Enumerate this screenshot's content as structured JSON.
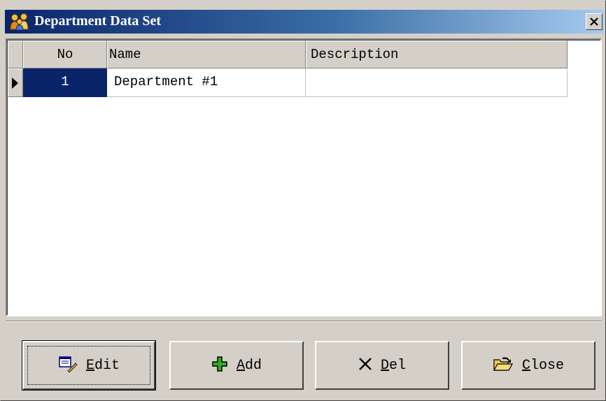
{
  "window": {
    "title": "Department Data Set",
    "icon": "people-icon"
  },
  "grid": {
    "columns": [
      "No",
      "Name",
      "Description"
    ],
    "rows": [
      {
        "no": "1",
        "name": "Department #1",
        "description": ""
      }
    ],
    "selected_row": 1
  },
  "buttons": {
    "edit": {
      "accel": "E",
      "rest": "dit",
      "icon": "edit-icon"
    },
    "add": {
      "accel": "A",
      "rest": "dd",
      "icon": "plus-icon"
    },
    "del": {
      "accel": "D",
      "rest": "el",
      "icon": "x-icon"
    },
    "close": {
      "accel": "C",
      "rest": "lose",
      "icon": "open-folder-icon"
    }
  },
  "colors": {
    "titlebar_start": "#0a246a",
    "titlebar_end": "#a6caf0",
    "selection": "#0a246a",
    "face": "#d4d0c8",
    "add_icon": "#2fae1e"
  }
}
